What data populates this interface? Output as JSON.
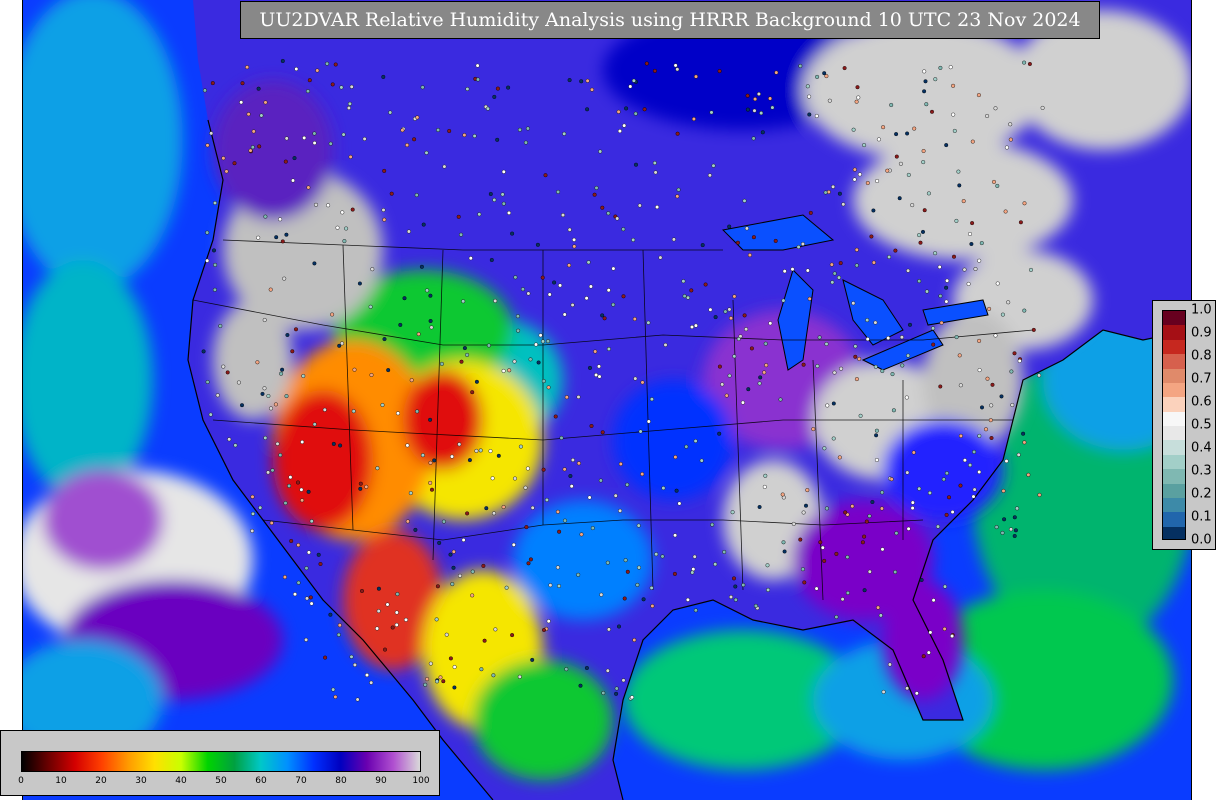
{
  "title": "UU2DVAR Relative Humidity Analysis using HRRR Background 10 UTC 23 Nov 2024",
  "rh_colorbar": {
    "ticks": [
      "0",
      "10",
      "20",
      "30",
      "40",
      "50",
      "60",
      "70",
      "80",
      "90",
      "100"
    ],
    "colors": [
      "#000000",
      "#6b0000",
      "#d40000",
      "#ff4000",
      "#ff9a00",
      "#ffe000",
      "#c8ff00",
      "#00d400",
      "#00a040",
      "#00c8c8",
      "#0090ff",
      "#0030ff",
      "#0000c0",
      "#6a00b0",
      "#b050d0",
      "#d9d9d9"
    ]
  },
  "increment_colorbar": {
    "ticks": [
      "1.0",
      "0.9",
      "0.8",
      "0.7",
      "0.6",
      "0.5",
      "0.4",
      "0.3",
      "0.2",
      "0.1",
      "0.0"
    ],
    "colors": [
      "#67001f",
      "#a50f15",
      "#c6281f",
      "#d6604d",
      "#e08a6a",
      "#f4a582",
      "#fbd2bc",
      "#f7f7f7",
      "#e8e8e8",
      "#c7dedb",
      "#a2cfc8",
      "#7fb8b2",
      "#5aa0a0",
      "#3d8aa8",
      "#2166ac",
      "#053061"
    ]
  },
  "map_colors": {
    "ocean_blue": "#0a3cff",
    "ocean_cyan": "#0aa0e6",
    "ocean_green": "#00b46e",
    "land_gray": "#cccccc",
    "purple": "#7a00c8",
    "dry_red": "#e01010",
    "orange": "#ff8c00",
    "yellow": "#f5e600",
    "green": "#10c830"
  }
}
